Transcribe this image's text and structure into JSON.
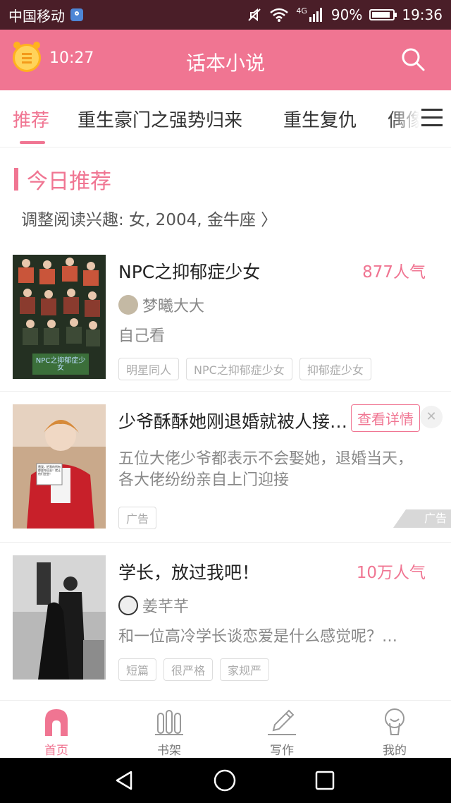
{
  "status_bar": {
    "carrier": "中国移动",
    "network": "4G",
    "battery": "90%",
    "battery_level": 0.9,
    "time": "19:36"
  },
  "app_bar": {
    "title": "话本小说",
    "timer": "10:27"
  },
  "tabs": [
    "推荐",
    "重生豪门之强势归来",
    "重生复仇",
    "偶像"
  ],
  "section": {
    "title": "今日推荐",
    "interest": "调整阅读兴趣: 女, 2004, 金牛座 〉"
  },
  "books": [
    {
      "title": "NPC之抑郁症少女",
      "popularity": "877人气",
      "author": "梦曦大大",
      "desc": "自己看",
      "tags": [
        "明星同人",
        "NPC之抑郁症少女",
        "抑郁症少女"
      ],
      "cover_text": "NPC之抑郁症少女"
    },
    {
      "title": "少爷酥酥她刚退婚就被人接…",
      "desc_lines": [
        "五位大佬少爷都表示不会娶她，退婚当天，",
        "各大佬纷纷亲自上门迎接"
      ],
      "tag": "广告",
      "detail_label": "查看详情",
      "ad_mark": "广告",
      "cover_text": "替我，把我的所有都要夺回去！就让他们尝尝！"
    },
    {
      "title": "学长，放过我吧！",
      "popularity": "10万人气",
      "author": "姜芊芊",
      "desc": "和一位高冷学长谈恋爱是什么感觉呢？…",
      "tags": [
        "短篇",
        "很严格",
        "家规严"
      ]
    }
  ],
  "bottom_nav": [
    {
      "label": "首页",
      "icon": "home-icon",
      "active": true
    },
    {
      "label": "书架",
      "icon": "bookshelf-icon",
      "active": false
    },
    {
      "label": "写作",
      "icon": "pen-icon",
      "active": false
    },
    {
      "label": "我的",
      "icon": "profile-icon",
      "active": false
    }
  ],
  "colors": {
    "accent": "#f07592",
    "status_bar": "#4a1e28"
  }
}
